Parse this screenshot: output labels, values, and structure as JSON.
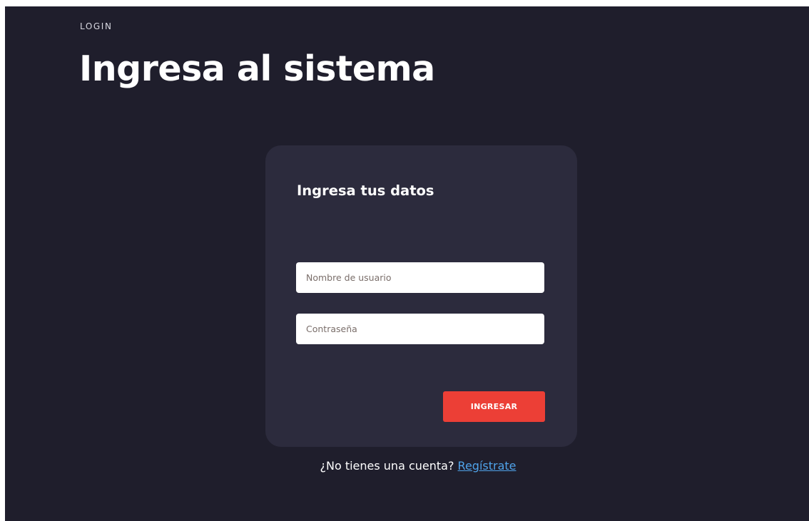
{
  "header": {
    "eyebrow": "LOGIN",
    "title": "Ingresa al sistema"
  },
  "login_card": {
    "title": "Ingresa tus datos",
    "username_placeholder": "Nombre de usuario",
    "password_placeholder": "Contraseña",
    "submit_label": "INGRESAR"
  },
  "signup": {
    "prompt": "¿No tienes una cuenta?",
    "link_label": "Regístrate"
  },
  "colors": {
    "background": "#1f1e2c",
    "card": "#2c2b3d",
    "accent": "#ec3f36",
    "link": "#4fa3ea"
  }
}
